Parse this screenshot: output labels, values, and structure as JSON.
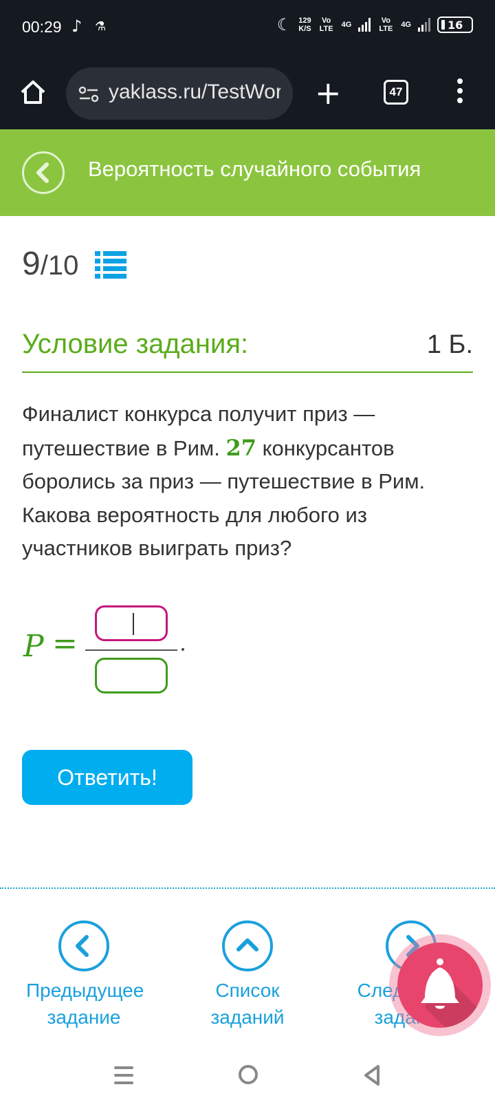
{
  "status_bar": {
    "time": "00:29",
    "net_speed_value": "129",
    "net_speed_unit": "K/S",
    "volte1": "Vo LTE",
    "signal1": "4G",
    "volte2": "Vo LTE",
    "signal2": "4G",
    "battery": "16",
    "icons": [
      "tiktok-icon",
      "flask-icon",
      "moon-icon",
      "signal-icon",
      "battery-icon"
    ]
  },
  "browser": {
    "url": "yaklass.ru/TestWork",
    "tab_count": "47",
    "plus_label": "+",
    "icons": [
      "home-icon",
      "site-settings-icon",
      "new-tab-icon",
      "tabs-icon",
      "menu-icon"
    ]
  },
  "topic": {
    "title": "Вероятность случайного события"
  },
  "progress": {
    "current": "9",
    "total": "/10"
  },
  "condition": {
    "title": "Условие задания:",
    "points": "1 Б."
  },
  "task": {
    "text_before": "Финалист конкурса получит приз — путешествие в Рим. ",
    "number": "27",
    "text_after": " конкурсантов боролись за приз — путешествие в Рим. Какова вероятность для любого из участников выиграть приз?"
  },
  "formula": {
    "variable": "P",
    "equals": "=",
    "numerator_value": "",
    "denominator_value": ""
  },
  "answer_button": "Ответить!",
  "bottom_nav": {
    "prev_line1": "Предыдущее",
    "prev_line2": "задание",
    "list_line1": "Список",
    "list_line2": "заданий",
    "next_line1": "Следующее",
    "next_line2": "задание"
  },
  "colors": {
    "accent_green": "#8bc53f",
    "title_green": "#5aac1a",
    "button_blue": "#00adef",
    "nav_blue": "#1aa0dc",
    "numerator_border": "#c4177e",
    "bell_pink": "#e8456c"
  }
}
